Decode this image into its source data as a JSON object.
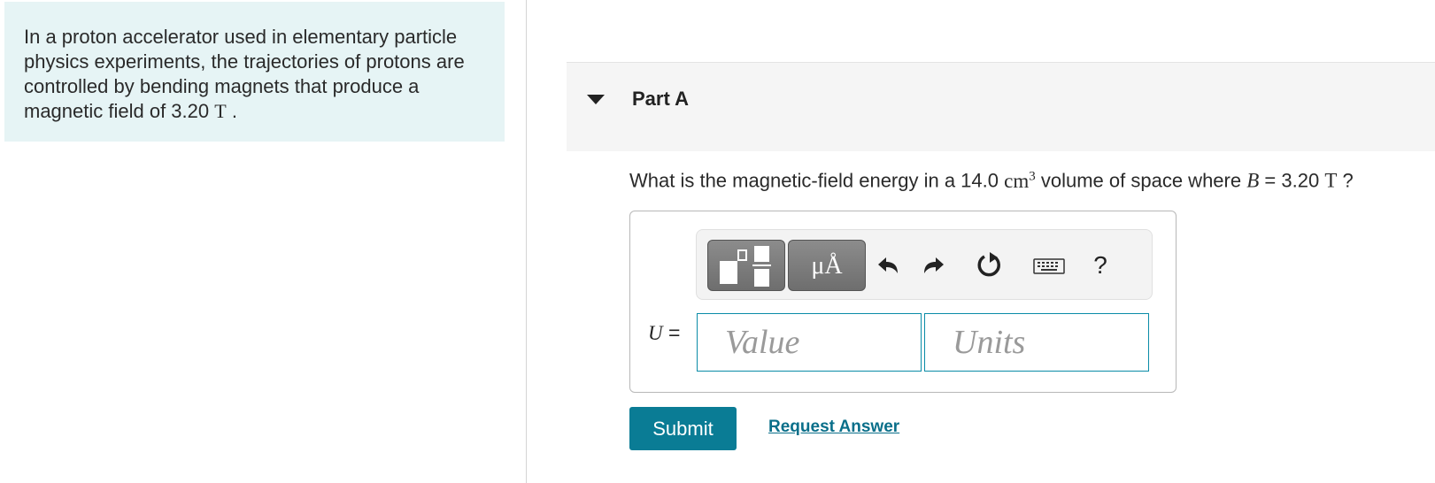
{
  "intro": {
    "text": "In a proton accelerator used in elementary particle physics experiments, the trajectories of protons are controlled by bending magnets that produce a magnetic field of 3.20",
    "unit": "T",
    "end": "."
  },
  "part": {
    "title": "Part A"
  },
  "question": {
    "text_a": "What is the magnetic-field energy in a 14.0",
    "volume_unit": "cm",
    "volume_exp": "3",
    "text_b": "volume of space where",
    "var": "B",
    "eq": "= 3.20",
    "field_unit": "T",
    "end": "?"
  },
  "toolbar": {
    "units_label": "μÅ",
    "help_label": "?",
    "icons": [
      "templates-icon",
      "units-icon",
      "undo-icon",
      "redo-icon",
      "reset-icon",
      "keyboard-icon",
      "help-icon"
    ]
  },
  "answer": {
    "var": "U",
    "eq": "=",
    "value_placeholder": "Value",
    "units_placeholder": "Units"
  },
  "buttons": {
    "submit": "Submit",
    "request_answer": "Request Answer"
  },
  "colors": {
    "intro_bg": "#e6f4f5",
    "accent": "#0a7c95",
    "link": "#0a6f8a",
    "input_border": "#0a8ca7"
  }
}
